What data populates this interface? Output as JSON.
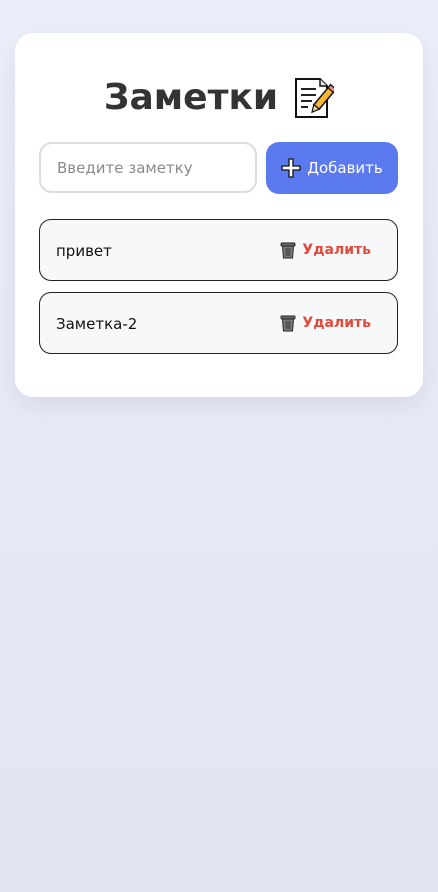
{
  "app": {
    "title": "Заметки",
    "title_icon": "memo-icon"
  },
  "form": {
    "input_value": "",
    "input_placeholder": "Введите заметку",
    "add_icon": "plus-icon",
    "add_label": "Добавить"
  },
  "notes": [
    {
      "text": "привет",
      "delete_icon": "trash-icon",
      "delete_label": "Удалить"
    },
    {
      "text": "Заметка-2",
      "delete_icon": "trash-icon",
      "delete_label": "Удалить"
    }
  ],
  "colors": {
    "accent": "#5b7af0",
    "danger": "#e04b3c",
    "title": "#333333"
  }
}
